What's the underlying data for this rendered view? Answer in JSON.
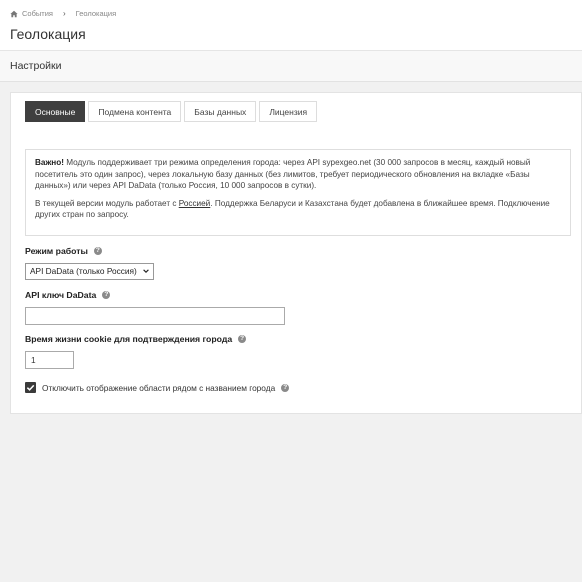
{
  "breadcrumb": {
    "items": [
      "События",
      "Геолокация"
    ]
  },
  "page": {
    "title": "Геолокация"
  },
  "section": {
    "title": "Настройки"
  },
  "tabs": [
    {
      "label": "Основные",
      "active": true
    },
    {
      "label": "Подмена контента",
      "active": false
    },
    {
      "label": "Базы данных",
      "active": false
    },
    {
      "label": "Лицензия",
      "active": false
    }
  ],
  "alert": {
    "strong": "Важно!",
    "p1": " Модуль поддерживает три режима определения города: через API sypexgeo.net (30 000 запросов в месяц, каждый новый посетитель это один запрос), через локальную базу данных (без лимитов, требует периодического обновления на вкладке «Базы данных») или через API DaData (только Россия, 10 000 запросов в сутки).",
    "p2_before": "В текущей версии модуль работает с ",
    "p2_link": "Россией",
    "p2_after": ". Поддержка Беларуси и Казахстана будет добавлена в ближайшее время. Подключение других стран по запросу."
  },
  "form": {
    "mode_label": "Режим работы",
    "mode_value": "API DaData (только Россия)",
    "api_key_label": "API ключ DaData",
    "api_key_value": "",
    "cookie_label": "Время жизни cookie для подтверждения города",
    "cookie_value": "1",
    "checkbox_label": "Отключить отображение области рядом с названием города",
    "checkbox_checked": true
  },
  "icons": {
    "home": "home-icon",
    "help": "question-circle-icon",
    "check": "check-icon",
    "dropdown": "chevron-down-icon"
  },
  "colors": {
    "active_tab": "#3f3f3f",
    "checkbox": "#3a3a3a"
  }
}
